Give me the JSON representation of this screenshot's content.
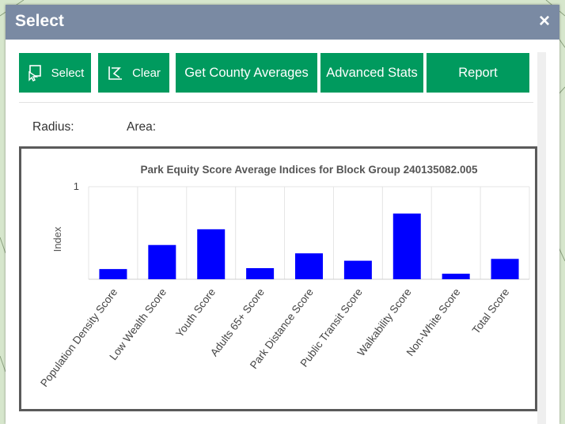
{
  "dialog": {
    "title": "Select",
    "close_label": "×"
  },
  "toolbar": {
    "select_label": "Select",
    "clear_label": "Clear",
    "county_label": "Get County Averages",
    "advanced_label": "Advanced Stats",
    "report_label": "Report"
  },
  "info": {
    "radius_label": "Radius:",
    "area_label": "Area:"
  },
  "colors": {
    "titlebar": "#7a8aa3",
    "button": "#009a5e",
    "bar": "#0000ff"
  },
  "chart_data": {
    "type": "bar",
    "title": "Park Equity Score Average Indices for Block Group 240135082.005",
    "ylabel": "Index",
    "xlabel": "",
    "ylim": [
      0,
      1
    ],
    "yticks": [
      "1"
    ],
    "categories": [
      "Population Density Score",
      "Low Wealth Score",
      "Youth Score",
      "Adults 65+ Score",
      "Park Distance Score",
      "Public Transit Score",
      "Walkability Score",
      "Non-White Score",
      "Total Score"
    ],
    "values": [
      0.11,
      0.37,
      0.54,
      0.12,
      0.28,
      0.2,
      0.71,
      0.06,
      0.22
    ],
    "grid": true,
    "legend": "none"
  }
}
